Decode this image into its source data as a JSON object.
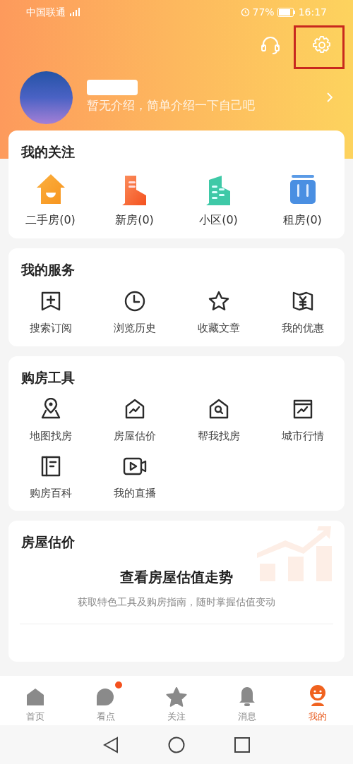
{
  "status_bar": {
    "carrier": "中国联通",
    "battery": "77%",
    "time": "16:17"
  },
  "profile": {
    "intro": "暂无介绍，简单介绍一下自己吧"
  },
  "follow": {
    "title": "我的关注",
    "items": [
      {
        "kind": "house",
        "label": "二手房(0)"
      },
      {
        "kind": "newbuilding",
        "label": "新房(0)"
      },
      {
        "kind": "estate",
        "label": "小区(0)"
      },
      {
        "kind": "luggage",
        "label": "租房(0)"
      }
    ]
  },
  "services": {
    "title": "我的服务",
    "items": [
      {
        "kind": "bookmark",
        "label": "搜索订阅"
      },
      {
        "kind": "clock",
        "label": "浏览历史"
      },
      {
        "kind": "star",
        "label": "收藏文章"
      },
      {
        "kind": "coupon",
        "label": "我的优惠"
      }
    ]
  },
  "tools": {
    "title": "购房工具",
    "items": [
      {
        "kind": "map",
        "label": "地图找房"
      },
      {
        "kind": "housechart",
        "label": "房屋估价"
      },
      {
        "kind": "housesearch",
        "label": "帮我找房"
      },
      {
        "kind": "chart",
        "label": "城市行情"
      },
      {
        "kind": "book",
        "label": "购房百科"
      },
      {
        "kind": "video",
        "label": "我的直播"
      }
    ]
  },
  "valuation": {
    "title": "房屋估价",
    "headline": "查看房屋估值走势",
    "description": "获取特色工具及购房指南，随时掌握估值变动"
  },
  "tabs": [
    {
      "kind": "home",
      "label": "首页",
      "selected": false,
      "badge": false
    },
    {
      "kind": "bubble",
      "label": "看点",
      "selected": false,
      "badge": true
    },
    {
      "kind": "star",
      "label": "关注",
      "selected": false,
      "badge": false
    },
    {
      "kind": "bell",
      "label": "消息",
      "selected": false,
      "badge": false
    },
    {
      "kind": "face",
      "label": "我的",
      "selected": true,
      "badge": false
    }
  ]
}
